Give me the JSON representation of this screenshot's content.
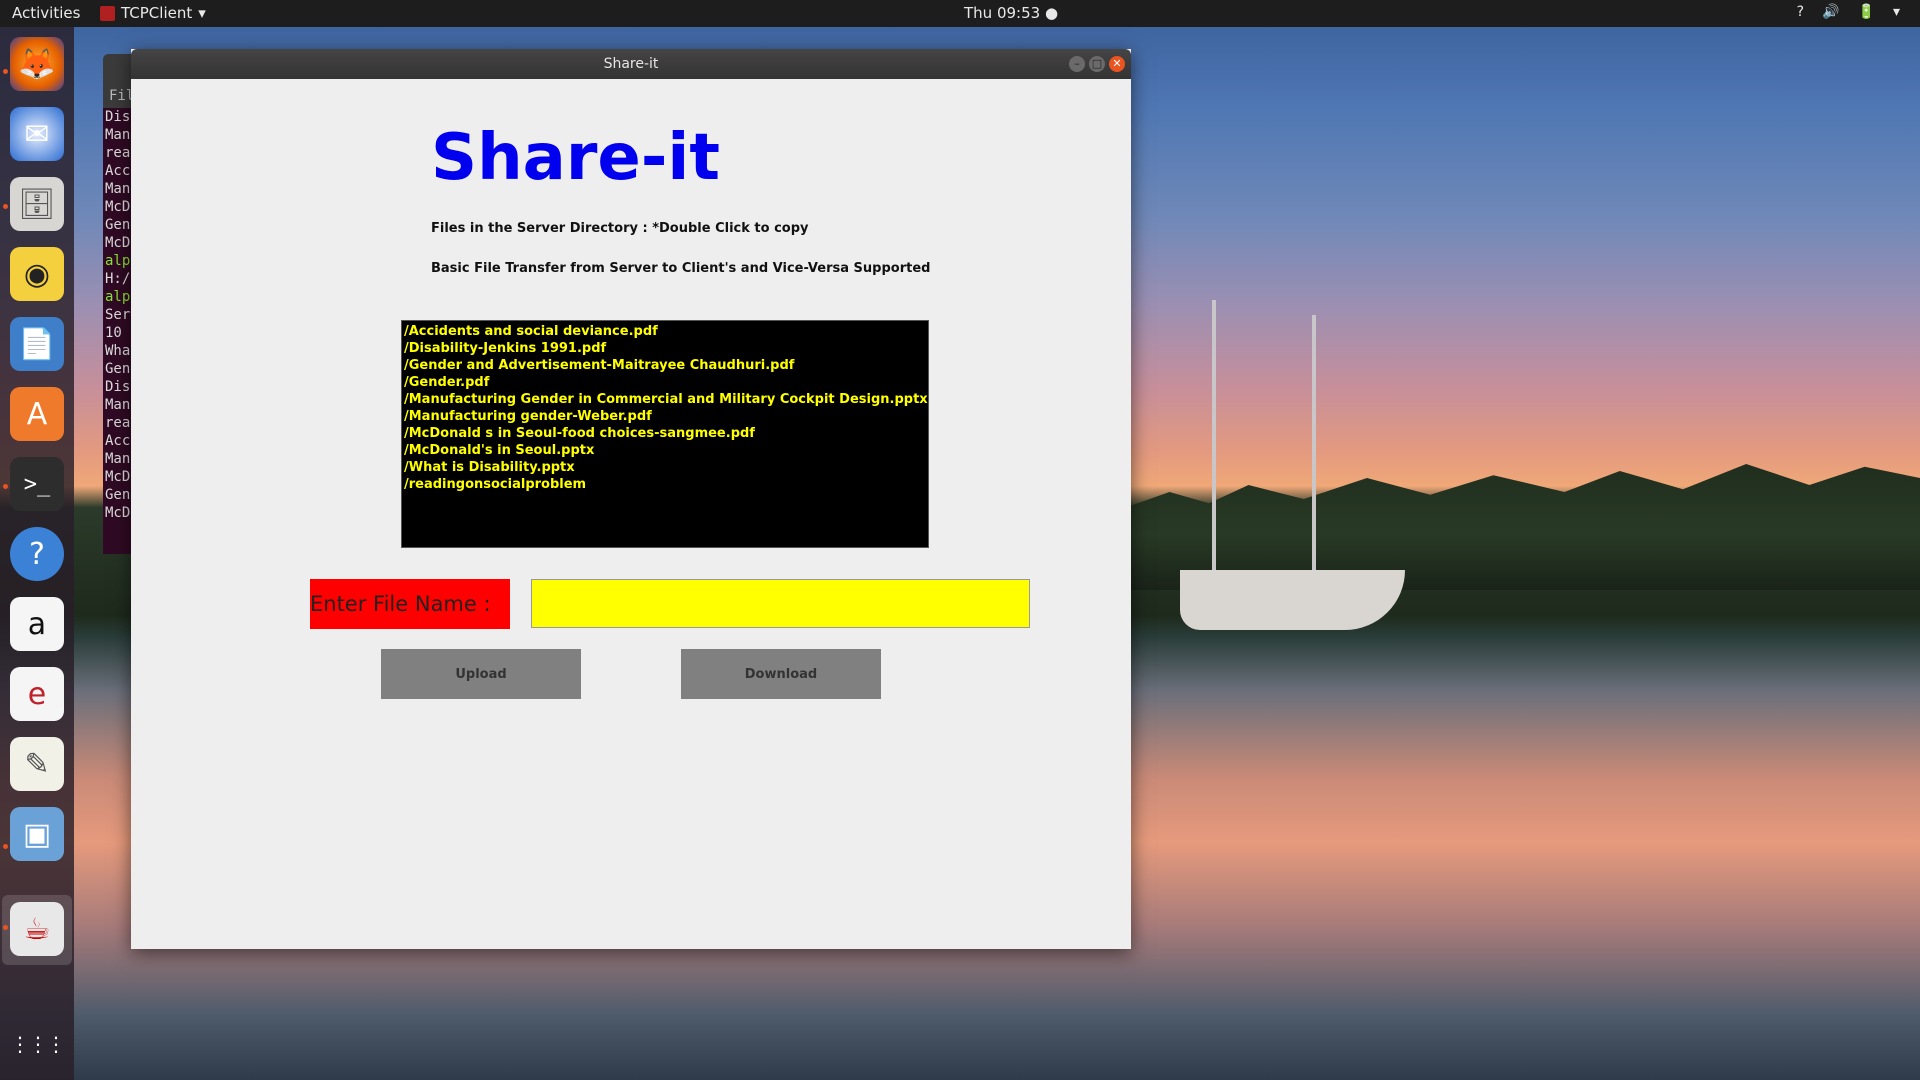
{
  "topbar": {
    "activities": "Activities",
    "app_name": "TCPClient",
    "clock": "Thu 09:53 ●",
    "status_icons": [
      "?",
      "🔊",
      "🔋",
      "▾"
    ]
  },
  "dock": {
    "items": [
      "firefox-icon",
      "thunderbird-icon",
      "files-icon",
      "rhythmbox-icon",
      "writer-icon",
      "software-center-icon",
      "terminal-icon",
      "help-icon",
      "amazon-icon",
      "ebook-reader-icon",
      "text-editor-icon",
      "virtualbox-icon",
      "java-icon",
      "show-apps-icon"
    ],
    "glyphs": [
      "🦊",
      "✉",
      "🗄",
      "◉",
      "📄",
      "A",
      ">_",
      "?",
      "a",
      "e",
      "✎",
      "▣",
      "☕",
      "⋮⋮⋮"
    ]
  },
  "terminal": {
    "menu_label": "File",
    "lines": [
      "Dis",
      "Man",
      "rea",
      "Acc",
      "Man",
      "McD",
      "Gen",
      "McD",
      "alp",
      "H:/",
      "alp",
      "Ser",
      "10",
      "Wha",
      "Gen",
      "Dis",
      "Man",
      "rea",
      "Acc",
      "Man",
      "McD",
      "Gen",
      "McD"
    ],
    "green_lines": [
      8,
      10
    ]
  },
  "window": {
    "title": "Share-it",
    "heading": "Share-it",
    "info_line1": "Files in the Server Directory : *Double Click to copy",
    "info_line2": "Basic File Transfer from Server to Client's and Vice-Versa Supported",
    "files": [
      "/Accidents and social deviance.pdf",
      "/Disability-Jenkins 1991.pdf",
      "/Gender and Advertisement-Maitrayee Chaudhuri.pdf",
      "/Gender.pdf",
      "/Manufacturing Gender in Commercial and Military Cockpit Design.pptx",
      "/Manufacturing gender-Weber.pdf",
      "/McDonald s in Seoul-food choices-sangmee.pdf",
      "/McDonald's in Seoul.pptx",
      "/What is Disability.pptx",
      "/readingonsocialproblem"
    ],
    "filename_label": "Enter File Name :",
    "filename_value": "",
    "upload_label": "Upload",
    "download_label": "Download"
  },
  "colors": {
    "heading": "#0000ee",
    "list_bg": "#000000",
    "list_text": "#ffff00",
    "label_bg": "#ff0000",
    "input_bg": "#ffff00",
    "button_bg": "#808080"
  }
}
